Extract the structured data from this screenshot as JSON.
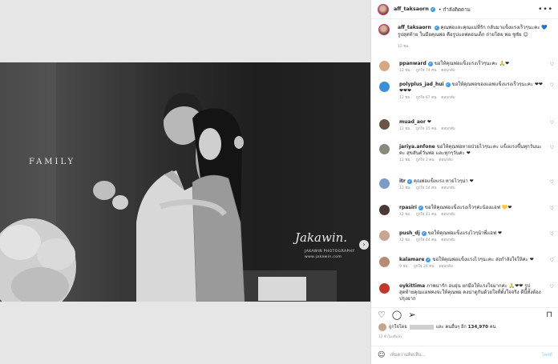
{
  "photo": {
    "caption_text": "FAMILY",
    "watermark_signature": "Jakawin.",
    "watermark_line1": "JAKAWIN PHOTOGRAPHY",
    "watermark_line2": "www.jakawin.com"
  },
  "header": {
    "username": "aff_taksaorn",
    "verified_mark": "✔",
    "follow_state": "• กำลังติดตาม",
    "more_icon": "•••"
  },
  "caption": {
    "username": "aff_taksaorn",
    "text": "คุณพ่อและคุณแม่ที่รัก กลับมาแข็งแรงเร็วๆนะคะ 💙 รูปสุดท้าย ในมือคุณพ่อ คือรูปแอฟตอนเด็ก ถ่ายโดย พ่อ ชูชัย 😊",
    "time": "12 ชม."
  },
  "comments": [
    {
      "user": "ppanward",
      "verified": true,
      "text": "ขอให้คุณพ่อแข็งแรงเร็วๆนะคะ 🙏❤",
      "time": "12 ชม.",
      "likes": "ถูกใจ 74 คน",
      "reply": "ตอบกลับ",
      "avatar_color": "#d9a77f"
    },
    {
      "user": "polyplus_jad_hui",
      "verified": true,
      "text": "ขอให้คุณพ่อของแอฟแข็งแรงเร็วๆนะคะ ❤❤❤❤❤",
      "time": "12 ชม.",
      "likes": "ถูกใจ 67 คน",
      "reply": "ตอบกลับ",
      "avatar_color": "#3d8fd6"
    },
    {
      "user": "muad_aor",
      "verified": false,
      "text": "❤",
      "time": "12 ชม.",
      "likes": "ถูกใจ 15 คน",
      "reply": "ตอบกลับ",
      "avatar_color": "#6b5446"
    },
    {
      "user": "jariya.anfone",
      "verified": false,
      "text": "ขอให้คุณพ่อหายป่วยไวๆนะคะ แข็งแรงขึ้นทุกวันนะคะ สุขสันต์วันพ่อ และทุกๆวันค่ะ ❤",
      "time": "12 ชม.",
      "likes": "ถูกใจ 2 คน",
      "reply": "ตอบกลับ",
      "avatar_color": "#8a8a7a"
    },
    {
      "user": "itr",
      "verified": true,
      "text": "คุณพ่อแข็งแรง หายไวๆน่า ❤",
      "time": "12 ชม.",
      "likes": "ถูกใจ 54 คน",
      "reply": "ตอบกลับ",
      "avatar_color": "#7a9cc6"
    },
    {
      "user": "rpasiri",
      "verified": true,
      "text": "ขอให้คุณพ่อแข็งแรงเร็วๆค่ะน้องแอฟ 💛❤",
      "time": "12 ชม.",
      "likes": "ถูกใจ 41 คน",
      "reply": "ตอบกลับ",
      "avatar_color": "#4a3a36"
    },
    {
      "user": "push_dj",
      "verified": true,
      "text": "ขอให้คุณพ่อแข็งแรงไวๆน้าพี่แอฟ ❤",
      "time": "12 ชม.",
      "likes": "ถูกใจ 44 คน",
      "reply": "ตอบกลับ",
      "avatar_color": "#c8a491"
    },
    {
      "user": "kalamare",
      "verified": true,
      "text": "ขอให้คุณพ่อแข็งแรงไวๆนะคะ ส่งกำลังใจให้ค่ะ ❤",
      "time": "9 ชม.",
      "likes": "ถูกใจ 26 คน",
      "reply": "ตอบกลับ",
      "avatar_color": "#b78b72"
    },
    {
      "user": "oykittima",
      "verified": false,
      "text": "ภาพน่ารัก อบอุ่น ยกมือให้แรงใจมากค่ะ 🙏❤❤ รูปสุดท้ายคุณแอฟคงจะให้คุณพ่อ คงน่าดูกันด้วยใจที่ตั้งใจจริง ดีนี้ทั้งต้องปรุงยาก",
      "time": "",
      "likes": "",
      "reply": "",
      "avatar_color": "#c0392b"
    }
  ],
  "actions": {
    "like_icon": "♡",
    "comment_icon": "◯",
    "share_icon": "➢",
    "bookmark_icon": "⊓"
  },
  "likes": {
    "prefix": "ถูกใจโดย",
    "suffix_prefix": "และ คนอื่นๆ อีก",
    "count": "134,970",
    "suffix_unit": "คน"
  },
  "date_label": "13 ชั่วโมงที่แล้ว",
  "add_comment": {
    "placeholder": "เพิ่มความคิดเห็น...",
    "post_label": "โพสต์",
    "emoji_icon": "☺"
  }
}
